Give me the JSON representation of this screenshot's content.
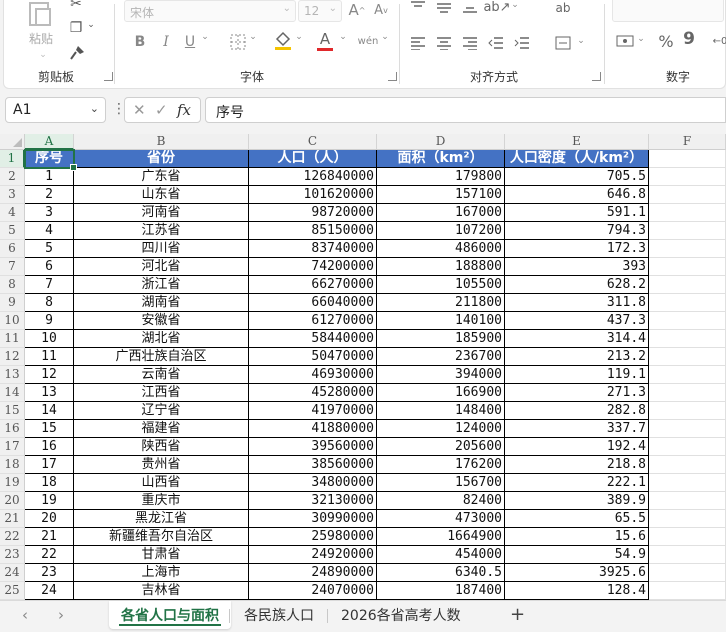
{
  "ribbon": {
    "clipboard": {
      "paste_label": "粘贴",
      "title": "剪贴板"
    },
    "font": {
      "name": "宋体",
      "size": "12",
      "title": "字体",
      "bold": "B",
      "italic": "I",
      "underline": "U",
      "font_color_glyph": "A",
      "phonetic_glyph": "wén"
    },
    "alignment": {
      "title": "对齐方式",
      "wrap_glyph": "ab"
    },
    "number": {
      "title": "数字",
      "percent": "%",
      "comma": "9"
    }
  },
  "formula_bar": {
    "cell_ref": "A1",
    "fx": "fx",
    "formula": "序号"
  },
  "columns": [
    "A",
    "B",
    "C",
    "D",
    "E",
    "F"
  ],
  "row_numbers": [
    "1",
    "2",
    "3",
    "4",
    "5",
    "6",
    "7",
    "8",
    "9",
    "10",
    "11",
    "12",
    "13",
    "14",
    "15",
    "16",
    "17",
    "18",
    "19",
    "20",
    "21",
    "22",
    "23",
    "24",
    "25"
  ],
  "table": {
    "headers": [
      "序号",
      "省份",
      "人口（人）",
      "面积（km²）",
      "人口密度（人/km²）"
    ],
    "rows": [
      [
        "1",
        "广东省",
        "126840000",
        "179800",
        "705.5"
      ],
      [
        "2",
        "山东省",
        "101620000",
        "157100",
        "646.8"
      ],
      [
        "3",
        "河南省",
        "98720000",
        "167000",
        "591.1"
      ],
      [
        "4",
        "江苏省",
        "85150000",
        "107200",
        "794.3"
      ],
      [
        "5",
        "四川省",
        "83740000",
        "486000",
        "172.3"
      ],
      [
        "6",
        "河北省",
        "74200000",
        "188800",
        "393"
      ],
      [
        "7",
        "浙江省",
        "66270000",
        "105500",
        "628.2"
      ],
      [
        "8",
        "湖南省",
        "66040000",
        "211800",
        "311.8"
      ],
      [
        "9",
        "安徽省",
        "61270000",
        "140100",
        "437.3"
      ],
      [
        "10",
        "湖北省",
        "58440000",
        "185900",
        "314.4"
      ],
      [
        "11",
        "广西壮族自治区",
        "50470000",
        "236700",
        "213.2"
      ],
      [
        "12",
        "云南省",
        "46930000",
        "394000",
        "119.1"
      ],
      [
        "13",
        "江西省",
        "45280000",
        "166900",
        "271.3"
      ],
      [
        "14",
        "辽宁省",
        "41970000",
        "148400",
        "282.8"
      ],
      [
        "15",
        "福建省",
        "41880000",
        "124000",
        "337.7"
      ],
      [
        "16",
        "陕西省",
        "39560000",
        "205600",
        "192.4"
      ],
      [
        "17",
        "贵州省",
        "38560000",
        "176200",
        "218.8"
      ],
      [
        "18",
        "山西省",
        "34800000",
        "156700",
        "222.1"
      ],
      [
        "19",
        "重庆市",
        "32130000",
        "82400",
        "389.9"
      ],
      [
        "20",
        "黑龙江省",
        "30990000",
        "473000",
        "65.5"
      ],
      [
        "21",
        "新疆维吾尔自治区",
        "25980000",
        "1664900",
        "15.6"
      ],
      [
        "22",
        "甘肃省",
        "24920000",
        "454000",
        "54.9"
      ],
      [
        "23",
        "上海市",
        "24890000",
        "6340.5",
        "3925.6"
      ],
      [
        "24",
        "吉林省",
        "24070000",
        "187400",
        "128.4"
      ]
    ]
  },
  "sheets": {
    "tabs": [
      "各省人口与面积",
      "各民族人口",
      "2026各省高考人数"
    ],
    "active_index": 0,
    "add_glyph": "+"
  },
  "colors": {
    "header_fill": "#4472c4",
    "accent": "#217346"
  }
}
